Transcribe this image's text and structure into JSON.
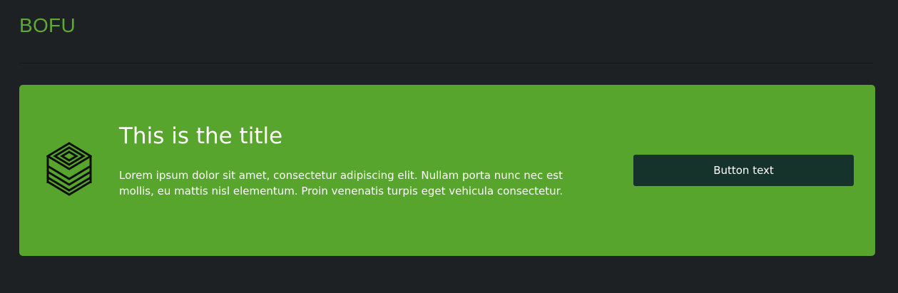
{
  "section": {
    "title": "BOFU"
  },
  "banner": {
    "icon": "layered-cube-icon",
    "title": "This is the title",
    "body": "Lorem ipsum dolor sit amet, consectetur adipiscing elit. Nullam porta nunc nec est mollis, eu mattis nisl elementum. Proin venenatis turpis eget vehicula consectetur.",
    "button_label": "Button text"
  },
  "colors": {
    "page_background": "#1e2124",
    "section_title": "#5fa932",
    "banner_background": "#58a52d",
    "button_background": "#15332a",
    "icon": "#0b0f0c"
  }
}
